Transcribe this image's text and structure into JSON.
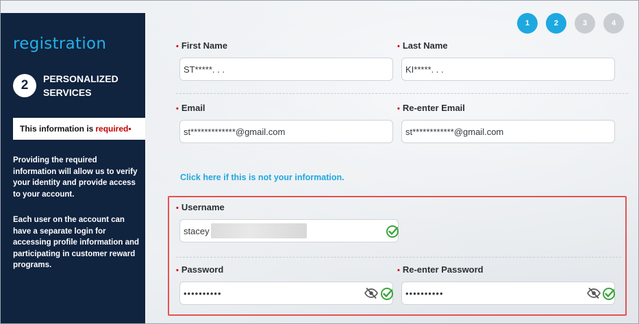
{
  "sidebar": {
    "brand": "registration",
    "step_number": "2",
    "step_title": "PERSONALIZED SERVICES",
    "required_prefix": "This information is",
    "required_word": "required",
    "required_mark": "•",
    "paragraph_1": "Providing the required information will allow us to verify your identity and provide access to your account.",
    "paragraph_2": "Each user on the account can have a separate login for accessing profile information and participating in customer reward programs."
  },
  "progress": {
    "steps": [
      "1",
      "2",
      "3",
      "4"
    ],
    "active_steps": 2
  },
  "form": {
    "required_marker": "•",
    "first_name_label": "First Name",
    "first_name_value": "ST*****. . .",
    "last_name_label": "Last Name",
    "last_name_value": "KI*****. . .",
    "email_label": "Email",
    "email_value": "st*************@gmail.com",
    "reenter_email_label": "Re-enter Email",
    "reenter_email_value": "st************@gmail.com",
    "not_your_info_link": "Click here if this is not your information.",
    "username_label": "Username",
    "username_value": "stacey",
    "password_label": "Password",
    "password_value": "••••••••••",
    "reenter_password_label": "Re-enter Password",
    "reenter_password_value": "••••••••••"
  },
  "colors": {
    "sidebar_bg": "#10233f",
    "accent": "#1ea8e0",
    "required": "#d0021b",
    "valid_check": "#3aa53a",
    "highlight": "#e35252"
  },
  "icons": [
    "eye-slash-icon",
    "check-circle-icon"
  ]
}
